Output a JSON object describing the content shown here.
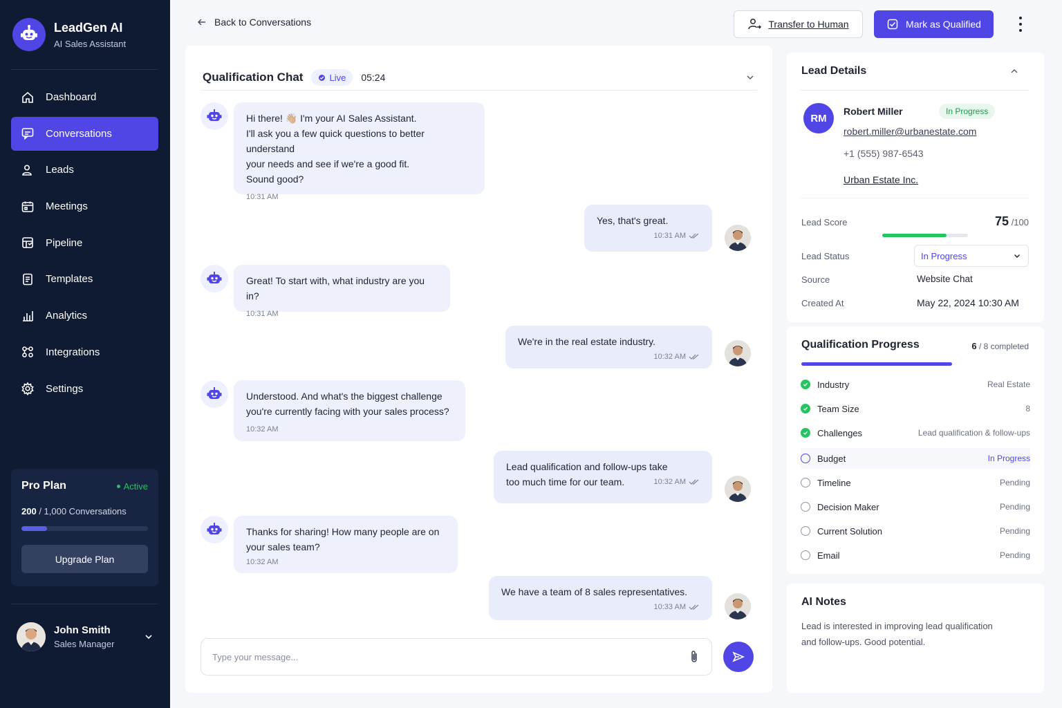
{
  "brand": {
    "name": "LeadGen AI",
    "subtitle": "AI Sales Assistant"
  },
  "nav": {
    "items": [
      {
        "label": "Dashboard",
        "icon": "home-icon"
      },
      {
        "label": "Conversations",
        "icon": "chat-icon",
        "active": true
      },
      {
        "label": "Leads",
        "icon": "users-icon"
      },
      {
        "label": "Meetings",
        "icon": "calendar-icon"
      },
      {
        "label": "Pipeline",
        "icon": "pipeline-icon"
      },
      {
        "label": "Templates",
        "icon": "template-icon"
      },
      {
        "label": "Analytics",
        "icon": "analytics-icon"
      },
      {
        "label": "Integrations",
        "icon": "integrations-icon"
      },
      {
        "label": "Settings",
        "icon": "gear-icon"
      }
    ]
  },
  "plan": {
    "title": "Pro Plan",
    "status": "Active",
    "used": "200",
    "total": " / 1,000 Conversations",
    "usage_fraction": 0.2,
    "upgrade_label": "Upgrade Plan"
  },
  "user": {
    "name": "John Smith",
    "role": "Sales Manager"
  },
  "topbar": {
    "back_label": "Back to Conversations",
    "transfer_label": "Transfer to Human",
    "qualified_label": "Mark as Qualified"
  },
  "chat": {
    "title": "Qualification Chat",
    "live_label": "Live",
    "timer": "05:24",
    "messages": [
      {
        "from": "bot",
        "lines": [
          "Hi there! 👋🏼 I'm your AI Sales Assistant.",
          "I'll ask you a few quick questions to better understand",
          "your needs and see if we're a good fit.",
          "Sound good?"
        ],
        "time": "10:31 AM"
      },
      {
        "from": "user",
        "lines": [
          "Yes, that's great."
        ],
        "time": "10:31 AM"
      },
      {
        "from": "bot",
        "lines": [
          "Great! To start with, what industry are you in?"
        ],
        "time": "10:31 AM"
      },
      {
        "from": "user",
        "lines": [
          "We're in the real estate industry."
        ],
        "time": "10:32 AM"
      },
      {
        "from": "bot",
        "lines": [
          "Understood. And what's the biggest challenge",
          "you're currently facing with your sales process?"
        ],
        "time": "10:32 AM"
      },
      {
        "from": "user",
        "lines": [
          "Lead qualification and follow-ups take",
          "too much time for our team."
        ],
        "time": "10:32 AM"
      },
      {
        "from": "bot",
        "lines": [
          "Thanks for sharing! How many people are on",
          "your sales team?"
        ],
        "time": "10:32 AM"
      },
      {
        "from": "user",
        "lines": [
          "We have a team of 8 sales representatives."
        ],
        "time": "10:33 AM"
      }
    ],
    "input_placeholder": "Type your message..."
  },
  "lead": {
    "title": "Lead Details",
    "initials": "RM",
    "name": "Robert Miller",
    "badge": "In Progress",
    "email": "robert.miller@urbanestate.com",
    "phone": "+1 (555) 987-6543",
    "company": "Urban Estate Inc.",
    "score_label": "Lead Score",
    "score": "75",
    "score_max": "/100",
    "score_fraction": 0.75,
    "status_label": "Lead Status",
    "status_value": "In Progress",
    "source_label": "Source",
    "source_value": "Website Chat",
    "created_label": "Created At",
    "created_value": "May 22, 2024 10:30 AM"
  },
  "qualification": {
    "title": "Qualification Progress",
    "completed": "6",
    "total_text": " / 8 completed",
    "items": [
      {
        "label": "Industry",
        "value": "Real Estate",
        "state": "done"
      },
      {
        "label": "Team Size",
        "value": "8",
        "state": "done"
      },
      {
        "label": "Challenges",
        "value": "Lead qualification & follow-ups",
        "state": "done"
      },
      {
        "label": "Budget",
        "value": "In Progress",
        "state": "current"
      },
      {
        "label": "Timeline",
        "value": "Pending",
        "state": "pending"
      },
      {
        "label": "Decision Maker",
        "value": "Pending",
        "state": "pending"
      },
      {
        "label": "Current Solution",
        "value": "Pending",
        "state": "pending"
      },
      {
        "label": "Email",
        "value": "Pending",
        "state": "pending"
      }
    ]
  },
  "notes": {
    "title": "AI Notes",
    "text_line1": "Lead is interested in improving lead qualification",
    "text_line2": "and follow-ups. Good potential."
  },
  "colors": {
    "accent": "#4f46e5",
    "sidebar": "#0f1a33",
    "success": "#22c55e"
  }
}
